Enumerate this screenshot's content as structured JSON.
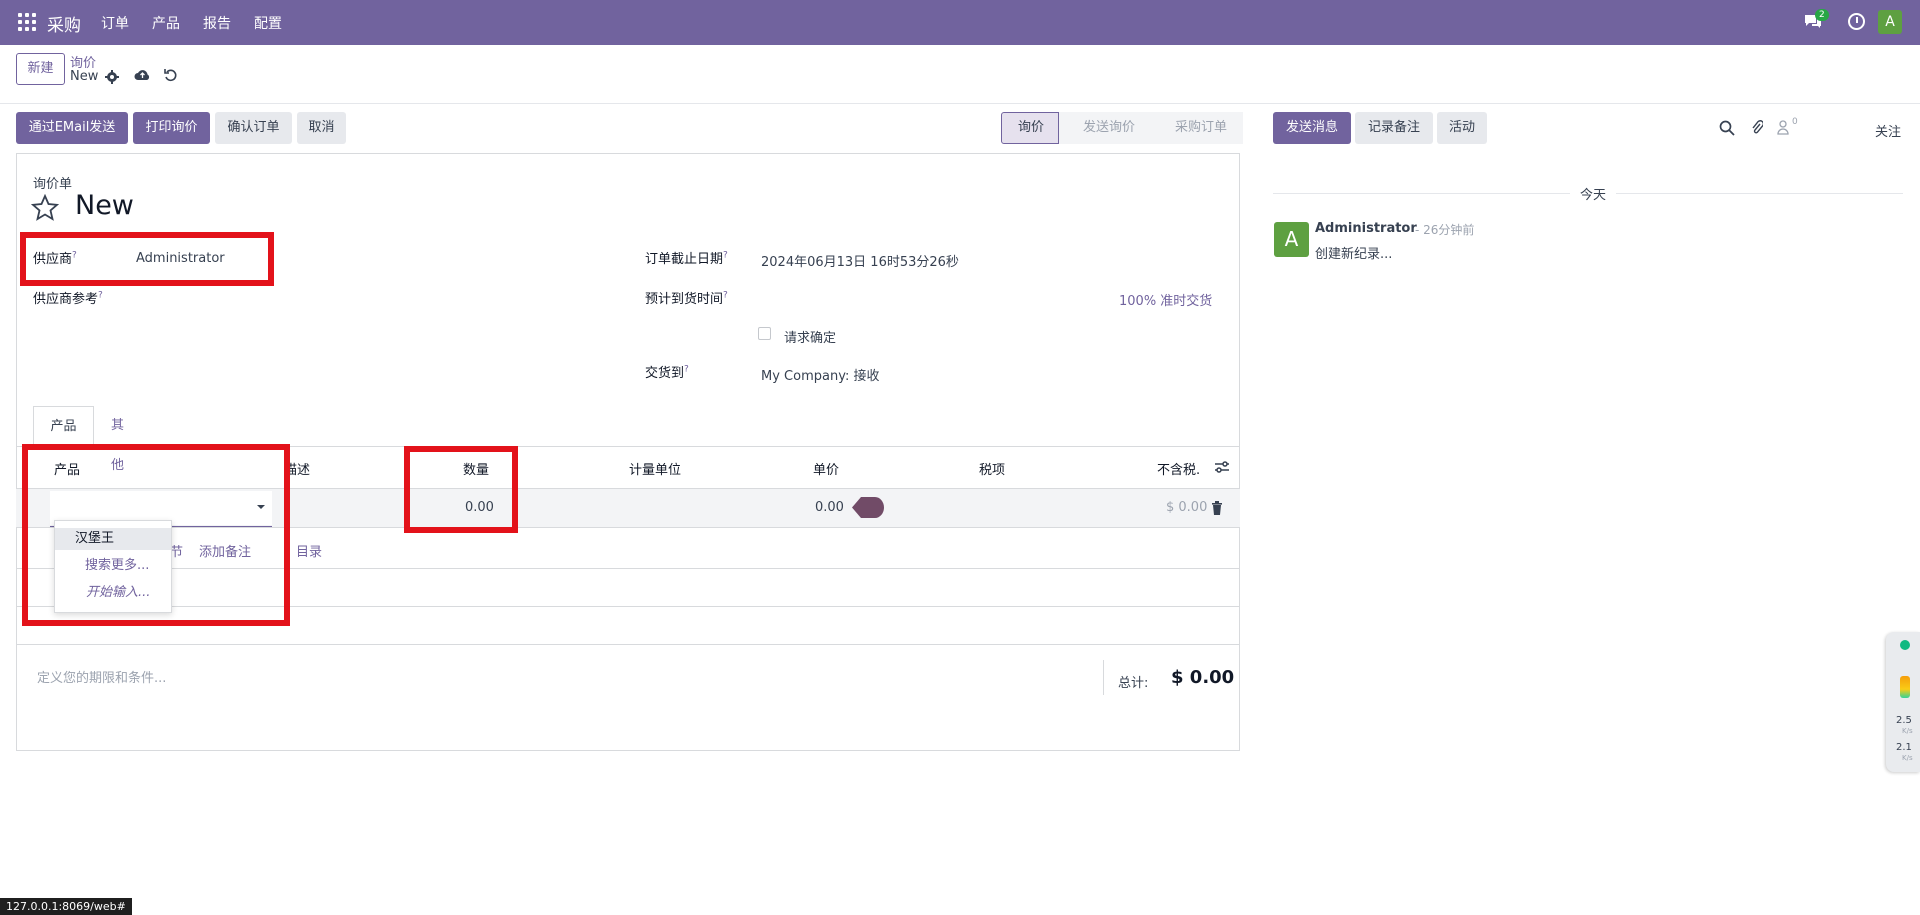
{
  "navbar": {
    "brand": "采购",
    "menu": [
      "订单",
      "产品",
      "报告",
      "配置"
    ],
    "chat_badge": "2",
    "avatar": "A"
  },
  "control_panel": {
    "new_button": "新建",
    "breadcrumb_parent": "询价",
    "breadcrumb_current": "New"
  },
  "actions": {
    "send_email": "通过EMail发送",
    "print": "打印询价",
    "confirm": "确认订单",
    "cancel": "取消"
  },
  "statusbar": [
    "询价",
    "发送询价",
    "采购订单"
  ],
  "form": {
    "doc_type": "询价单",
    "title": "New",
    "vendor_label": "供应商",
    "vendor_value": "Administrator",
    "vendor_ref_label": "供应商参考",
    "deadline_label": "订单截止日期",
    "deadline_value": "2024年06月13日 16时53分26秒",
    "expected_arrival_label": "预计到货时间",
    "ontime_value": "100% 准时交货",
    "ask_confirm_label": "请求确定",
    "deliver_to_label": "交货到",
    "deliver_to_value": "My Company: 接收",
    "help_mark": "?"
  },
  "tabs": [
    "产品",
    "其他信息"
  ],
  "table": {
    "headers": [
      "产品",
      "描述",
      "数量",
      "计量单位",
      "单价",
      "税项",
      "不含税."
    ],
    "row": {
      "qty": "0.00",
      "price": "0.00",
      "subtotal": "$ 0.00"
    },
    "add_links": [
      "节",
      "添加备注",
      "目录"
    ]
  },
  "dropdown": [
    "汉堡王",
    "搜索更多...",
    "开始输入..."
  ],
  "footer": {
    "terms_placeholder": "定义您的期限和条件...",
    "total_label": "总计:",
    "total_value": "$ 0.00"
  },
  "chatter": {
    "send_message": "发送消息",
    "log_note": "记录备注",
    "activity": "活动",
    "follower_count": "0",
    "follow": "关注",
    "day": "今天",
    "author": "Administrator",
    "time": "- 26分钟前",
    "body": "创建新纪录...",
    "avatar": "A"
  },
  "widget": {
    "up": "2.5",
    "up_unit": "K/s",
    "down": "2.1",
    "down_unit": "K/s"
  },
  "status_url": "127.0.0.1:8069/web#"
}
